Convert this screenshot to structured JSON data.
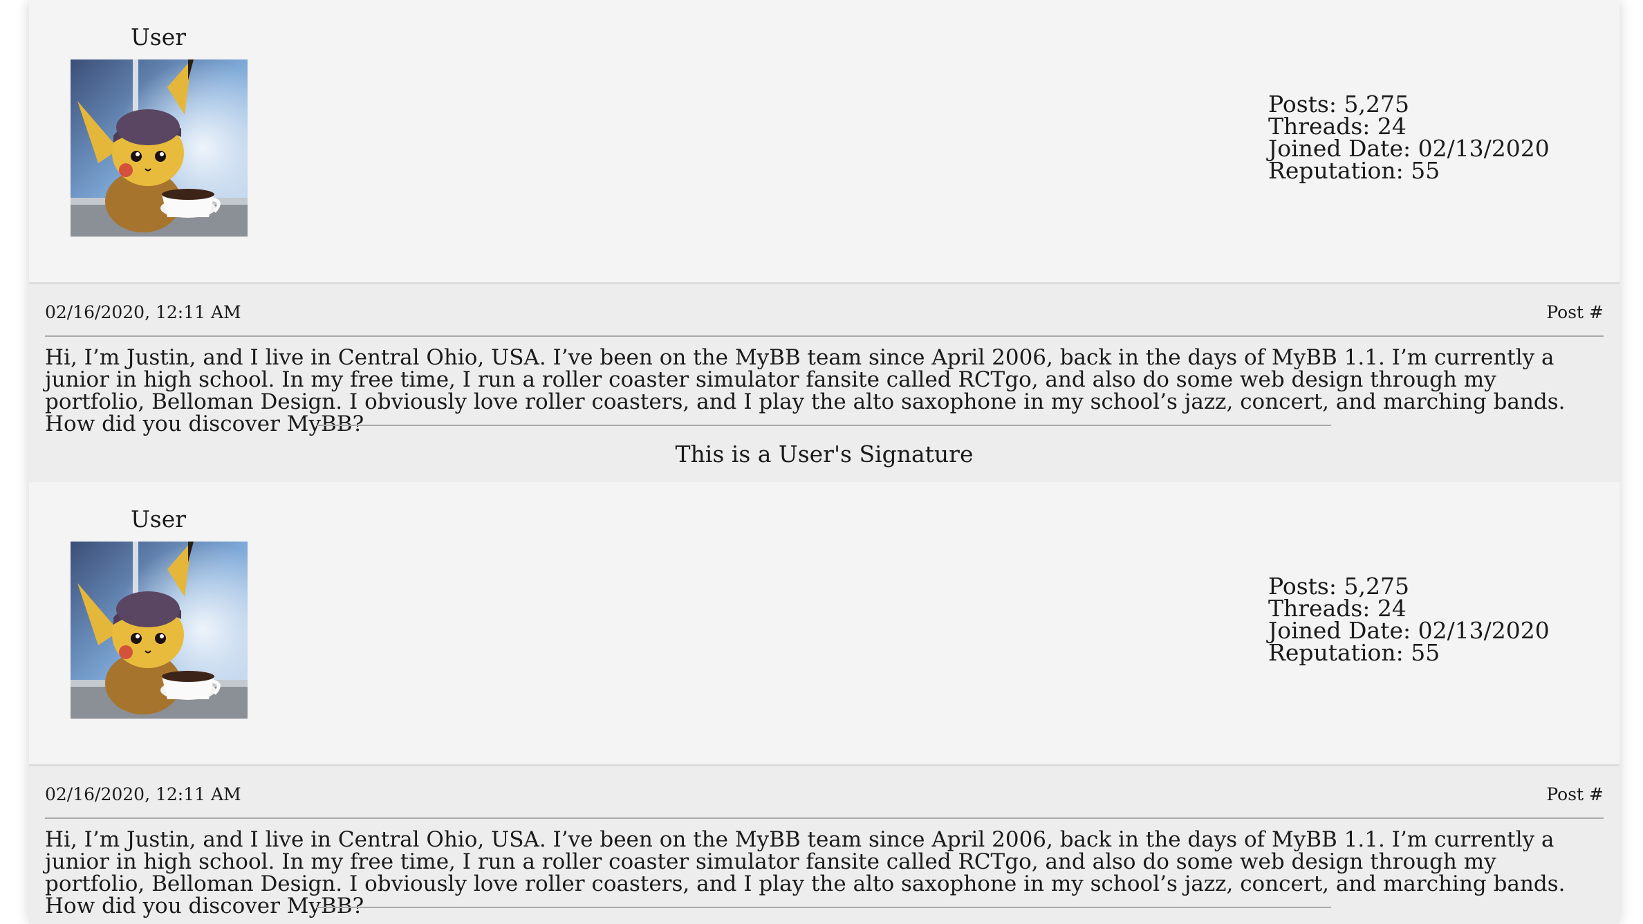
{
  "posts": [
    {
      "username": "User",
      "stats": {
        "posts": "Posts: 5,275",
        "threads": "Threads: 24",
        "joined": "Joined Date: 02/13/2020",
        "reputation": "Reputation: 55"
      },
      "date": "02/16/2020, 12:11 AM",
      "post_number": "Post #",
      "body": "Hi, I’m Justin, and I live in Central Ohio, USA. I’ve been on the MyBB team since April 2006, back in the days of MyBB 1.1. I’m currently a junior in high school. In my free time, I run a roller coaster simulator fansite called RCTgo, and also do some web design through my portfolio, Belloman Design. I obviously love roller coasters, and I play the alto saxophone in my school’s jazz, concert, and marching bands. How did you discover MyBB?",
      "signature": "This is a User's Signature"
    },
    {
      "username": "User",
      "stats": {
        "posts": "Posts: 5,275",
        "threads": "Threads: 24",
        "joined": "Joined Date: 02/13/2020",
        "reputation": "Reputation: 55"
      },
      "date": "02/16/2020, 12:11 AM",
      "post_number": "Post #",
      "body": "Hi, I’m Justin, and I live in Central Ohio, USA. I’ve been on the MyBB team since April 2006, back in the days of MyBB 1.1. I’m currently a junior in high school. In my free time, I run a roller coaster simulator fansite called RCTgo, and also do some web design through my portfolio, Belloman Design. I obviously love roller coasters, and I play the alto saxophone in my school’s jazz, concert, and marching bands. How did you discover MyBB?"
    }
  ],
  "avatar": {
    "icon": "pikachu-avatar-image"
  },
  "colors": {
    "page_bg": "#f4f4f4",
    "post_head_bg": "#ededed",
    "divider": "#a9a9a9"
  }
}
